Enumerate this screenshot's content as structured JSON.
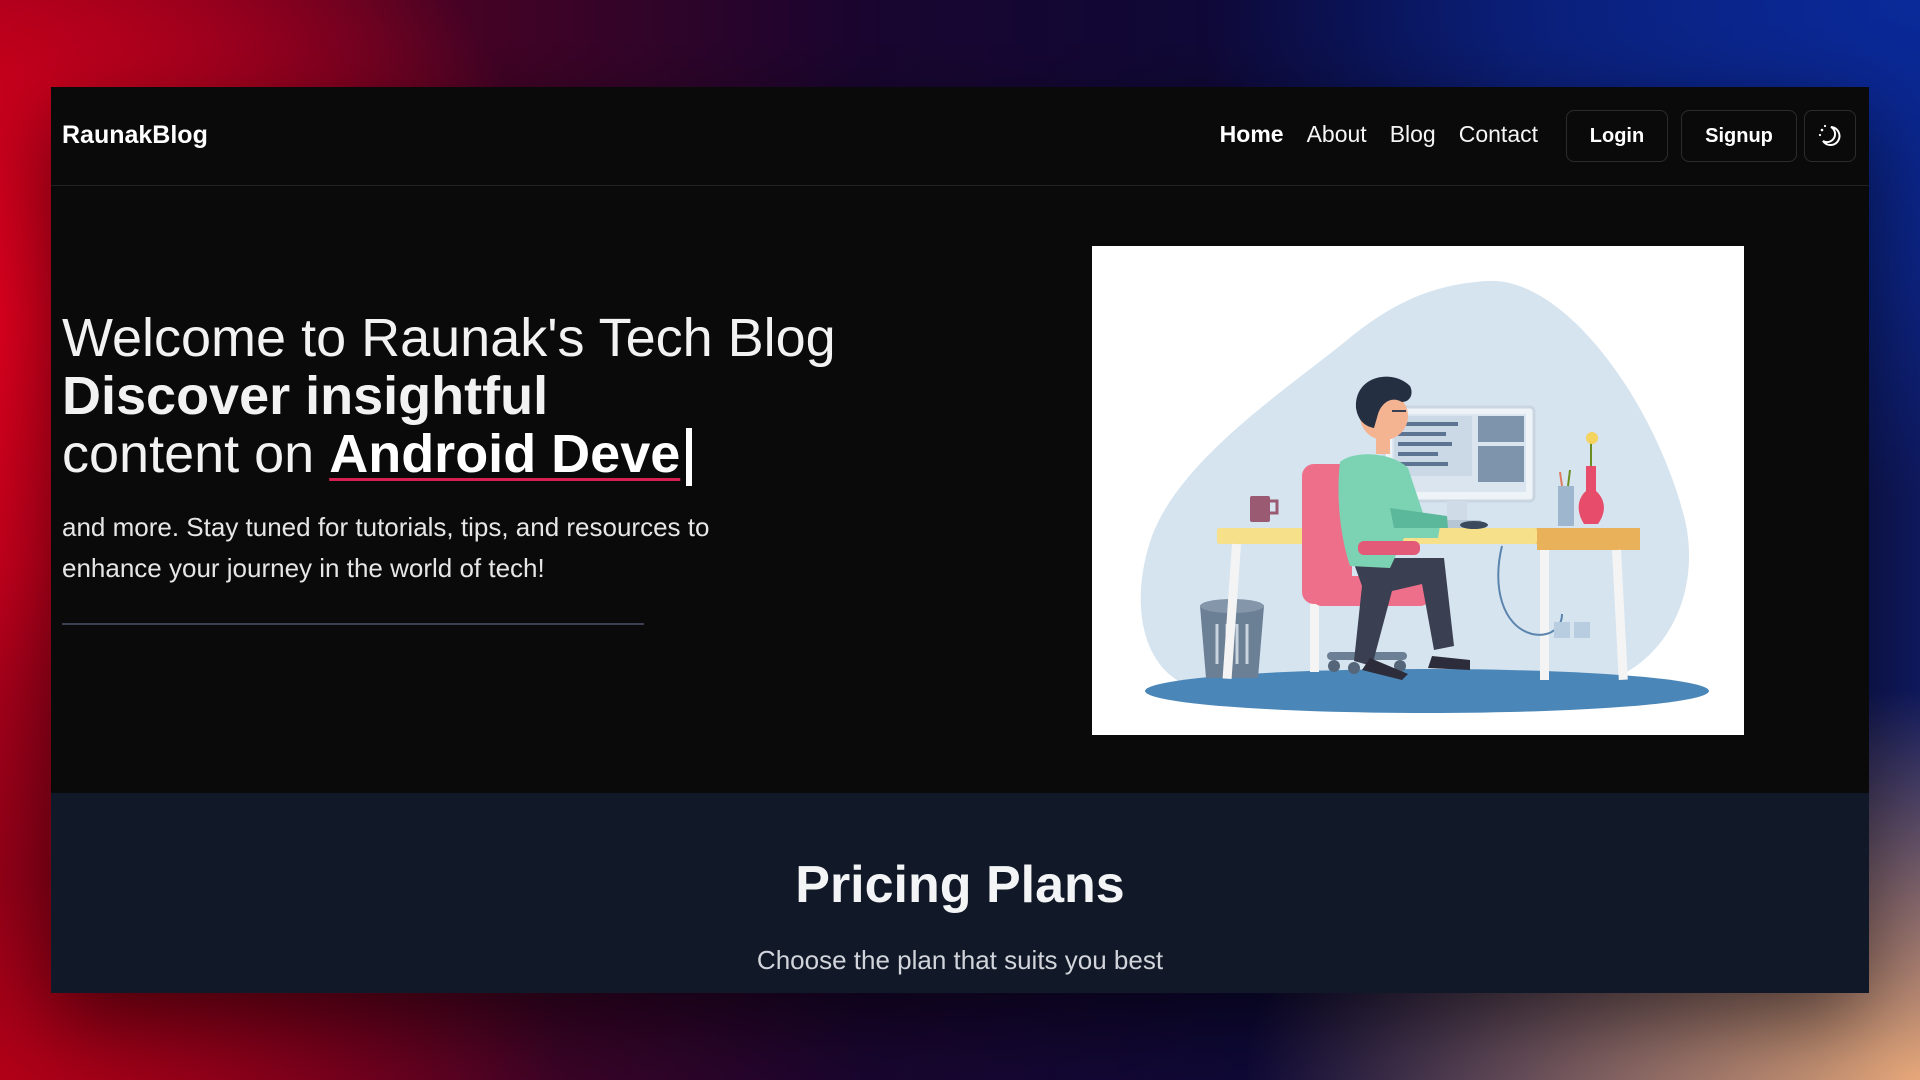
{
  "navbar": {
    "brand": "RaunakBlog",
    "links": [
      "Home",
      "About",
      "Blog",
      "Contact"
    ],
    "active_link": "Home",
    "login_label": "Login",
    "signup_label": "Signup",
    "theme_toggle_icon": "moon-sun-icon"
  },
  "hero": {
    "title_line1": "Welcome to Raunak's Tech Blog",
    "title_line2": "Discover insightful",
    "title_line3_prefix": "content on ",
    "typed_text": "Android Deve",
    "description": "and more. Stay tuned for tutorials, tips, and resources to enhance your journey in the world of tech!",
    "illustration_icon": "developer-at-desk-illustration"
  },
  "pricing": {
    "title": "Pricing Plans",
    "subtitle": "Choose the plan that suits you best"
  },
  "colors": {
    "page_bg": "#0a0a0a",
    "pricing_bg": "#111827",
    "typed_underline": "#d81f52",
    "illustration_blob": "#d6e4f0",
    "chair": "#ee6f8a",
    "floor": "#4a87b8"
  }
}
